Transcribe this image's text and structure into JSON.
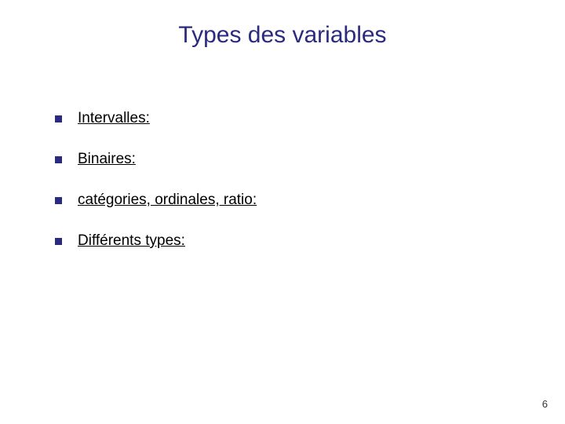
{
  "title": "Types des variables",
  "bullets": [
    "Intervalles:",
    "Binaires:",
    "catégories, ordinales, ratio:",
    "Différents types:"
  ],
  "page_number": "6"
}
